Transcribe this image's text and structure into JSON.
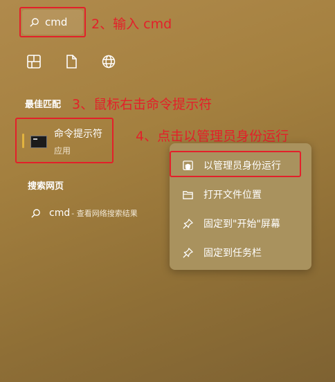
{
  "search": {
    "query": "cmd"
  },
  "annotations": {
    "step2": "2、输入 cmd",
    "step3": "3、鼠标右击命令提示符",
    "step4": "4、点击以管理员身份运行"
  },
  "filters": [
    "apps-icon",
    "documents-icon",
    "web-icon"
  ],
  "best_match": {
    "title": "最佳匹配",
    "app_name": "命令提示符",
    "app_type": "应用"
  },
  "web_search": {
    "title": "搜索网页",
    "query": "cmd",
    "suffix": "- 查看网络搜索结果"
  },
  "context_menu": {
    "items": [
      {
        "label": "以管理员身份运行",
        "icon": "admin-shield-icon"
      },
      {
        "label": "打开文件位置",
        "icon": "folder-icon"
      },
      {
        "label": "固定到\"开始\"屏幕",
        "icon": "pin-icon"
      },
      {
        "label": "固定到任务栏",
        "icon": "pin-icon"
      }
    ]
  },
  "colors": {
    "highlight_red": "#e3202a",
    "accent_yellow": "#e2b33f"
  }
}
